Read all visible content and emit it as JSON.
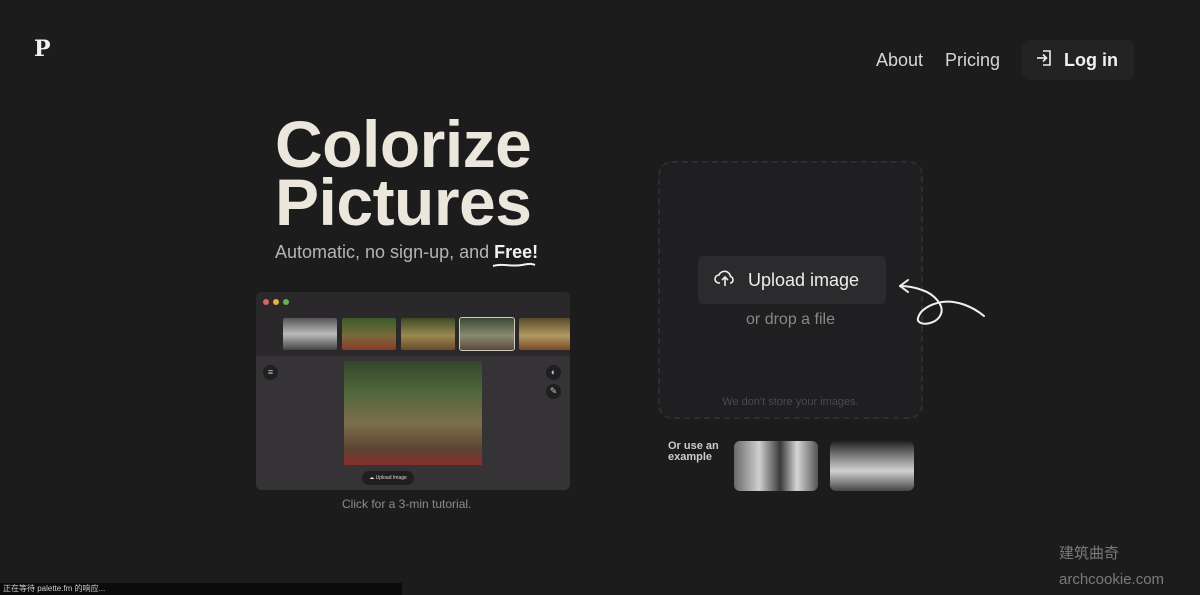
{
  "brand": {
    "logo_letter": "P"
  },
  "nav": {
    "about": "About",
    "pricing": "Pricing",
    "login": "Log in"
  },
  "hero": {
    "title_line1": "Colorize",
    "title_line2": "Pictures",
    "subtitle_prefix": "Automatic, no sign-up, and ",
    "subtitle_emphasis": "Free!"
  },
  "tutorial": {
    "caption": "Click for a 3-min tutorial.",
    "mini_upload_label": "Upload Image"
  },
  "upload": {
    "button_label": "Upload image",
    "drop_text": "or drop a file",
    "privacy_note": "We don't store your images."
  },
  "examples": {
    "label_line1": "Or use an",
    "label_line2": "example"
  },
  "watermark": {
    "line1": "建筑曲奇",
    "line2": "archcookie.com"
  },
  "status_bar": {
    "text": "正在等待 palette.fm 的响应..."
  },
  "colors": {
    "background": "#1d1c1d",
    "title": "#ebe7dd",
    "traffic_red": "#e0605a",
    "traffic_yellow": "#e3b341",
    "traffic_green": "#5fb24f"
  }
}
